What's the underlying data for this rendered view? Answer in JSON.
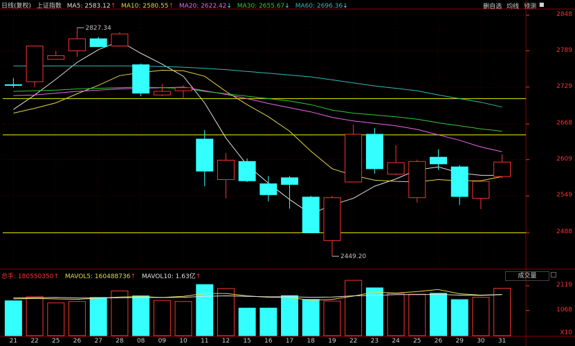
{
  "header": {
    "period": "日线(复权)",
    "index": "上证指数",
    "ma5": "MA5: 2583.12",
    "ma5_arrow": "↑",
    "ma10": "MA10: 2580.55",
    "ma10_arrow": "↑",
    "ma20": "MA20: 2622.42",
    "ma20_arrow": "↓",
    "ma30": "MA30: 2655.67",
    "ma30_arrow": "↓",
    "ma60": "MA60: 2696.36",
    "ma60_arrow": "↓"
  },
  "toolbar": {
    "watchlist": "删自选",
    "avg": "均线",
    "forecast": "预测",
    "box": "■"
  },
  "volume_header": {
    "total": "总手: 180550350",
    "total_arrow": "↑",
    "mavol5": "MAVOL5: 160488736",
    "mavol5_arrow": "↑",
    "mavol10": "MAVOL10: 1.63亿",
    "mavol10_arrow": "↑",
    "selector": "成交量"
  },
  "colors": {
    "up": "#ff3333",
    "down": "#33ffff",
    "ma5": "#e0e0e0",
    "ma10": "#e5d84a",
    "ma20": "#ee66ee",
    "ma30": "#33cc33",
    "ma60": "#33bbbb",
    "hline": "#c8c800",
    "grid": "#8b0000"
  },
  "chart_data": [
    {
      "type": "candlestick",
      "y_ticks": [
        "2848",
        "2789",
        "2729",
        "2668",
        "2609",
        "2549",
        "2488"
      ],
      "ylim": [
        2430,
        2856
      ],
      "x_tick_labels": [
        "21",
        "22",
        "25",
        "26",
        "27",
        "28",
        "08",
        "09",
        "10",
        "11",
        "12",
        "15",
        "16",
        "17",
        "18",
        "19",
        "22",
        "23",
        "24",
        "25",
        "26",
        "29",
        "30",
        "31"
      ],
      "candles": [
        {
          "o": 2733,
          "c": 2733,
          "h": 2744,
          "l": 2728,
          "dir": "down"
        },
        {
          "o": 2738,
          "c": 2797,
          "h": 2797,
          "l": 2729,
          "dir": "up"
        },
        {
          "o": 2775,
          "c": 2781,
          "h": 2789,
          "l": 2775,
          "dir": "up"
        },
        {
          "o": 2789,
          "c": 2809,
          "h": 2827.34,
          "l": 2779,
          "dir": "up"
        },
        {
          "o": 2809,
          "c": 2796,
          "h": 2812,
          "l": 2796,
          "dir": "down"
        },
        {
          "o": 2797,
          "c": 2817,
          "h": 2820,
          "l": 2796,
          "dir": "up"
        },
        {
          "o": 2766,
          "c": 2719,
          "h": 2768,
          "l": 2714,
          "dir": "down"
        },
        {
          "o": 2716,
          "c": 2722,
          "h": 2734,
          "l": 2714,
          "dir": "up"
        },
        {
          "o": 2723,
          "c": 2728,
          "h": 2732,
          "l": 2710,
          "dir": "up"
        },
        {
          "o": 2643,
          "c": 2590,
          "h": 2658,
          "l": 2565,
          "dir": "down"
        },
        {
          "o": 2576,
          "c": 2608,
          "h": 2620,
          "l": 2545,
          "dir": "up"
        },
        {
          "o": 2606,
          "c": 2574,
          "h": 2611,
          "l": 2572,
          "dir": "down"
        },
        {
          "o": 2569,
          "c": 2551,
          "h": 2582,
          "l": 2540,
          "dir": "down"
        },
        {
          "o": 2579,
          "c": 2568,
          "h": 2582,
          "l": 2528,
          "dir": "down"
        },
        {
          "o": 2547,
          "c": 2488,
          "h": 2549,
          "l": 2488,
          "dir": "down"
        },
        {
          "o": 2475,
          "c": 2546,
          "h": 2549,
          "l": 2449.2,
          "dir": "up"
        },
        {
          "o": 2572,
          "c": 2651,
          "h": 2667,
          "l": 2572,
          "dir": "up"
        },
        {
          "o": 2651,
          "c": 2594,
          "h": 2661,
          "l": 2586,
          "dir": "down"
        },
        {
          "o": 2585,
          "c": 2604,
          "h": 2633,
          "l": 2583,
          "dir": "up"
        },
        {
          "o": 2546,
          "c": 2606,
          "h": 2609,
          "l": 2538,
          "dir": "up"
        },
        {
          "o": 2613,
          "c": 2602,
          "h": 2626,
          "l": 2592,
          "dir": "down"
        },
        {
          "o": 2597,
          "c": 2548,
          "h": 2600,
          "l": 2534,
          "dir": "down"
        },
        {
          "o": 2545,
          "c": 2573,
          "h": 2573,
          "l": 2527,
          "dir": "up"
        },
        {
          "o": 2581,
          "c": 2605,
          "h": 2618,
          "l": 2578,
          "dir": "up"
        }
      ],
      "ma": {
        "ma5": [
          2692,
          2716,
          2742,
          2770,
          2791,
          2805,
          2785,
          2767,
          2747,
          2703,
          2645,
          2600,
          2570,
          2543,
          2519,
          2534,
          2545,
          2565,
          2577,
          2592,
          2597,
          2587,
          2583,
          2583
        ],
        "ma10": [
          2686,
          2694,
          2703,
          2718,
          2732,
          2748,
          2753,
          2757,
          2756,
          2747,
          2722,
          2700,
          2680,
          2656,
          2623,
          2594,
          2583,
          2575,
          2573,
          2572,
          2576,
          2574,
          2574,
          2581
        ],
        "ma20": [
          2715,
          2716,
          2719,
          2722,
          2724,
          2726,
          2727,
          2728,
          2729,
          2723,
          2717,
          2710,
          2702,
          2695,
          2688,
          2679,
          2673,
          2669,
          2665,
          2659,
          2650,
          2641,
          2630,
          2622
        ],
        "ma30": [
          2722,
          2723,
          2724,
          2726,
          2727,
          2728,
          2729,
          2728,
          2727,
          2722,
          2718,
          2714,
          2710,
          2706,
          2700,
          2691,
          2686,
          2683,
          2680,
          2676,
          2670,
          2665,
          2660,
          2656
        ],
        "ma60": [
          2764,
          2764,
          2764,
          2764,
          2764,
          2764,
          2764,
          2763,
          2762,
          2760,
          2758,
          2755,
          2752,
          2749,
          2746,
          2741,
          2736,
          2731,
          2727,
          2723,
          2716,
          2710,
          2704,
          2696
        ]
      },
      "horizontal_lines": [
        2710,
        2650,
        2488
      ],
      "annotations": [
        {
          "text": "2827.34",
          "candle": 3
        },
        {
          "text": "2449.20",
          "candle": 15
        }
      ]
    },
    {
      "type": "bar",
      "y_ticks": [
        "2119",
        "1068"
      ],
      "y_tick_values": [
        2119,
        1068
      ],
      "unit_label": "X10",
      "ylim": [
        0,
        2500
      ],
      "volumes": [
        1480,
        1650,
        1390,
        1450,
        1620,
        1900,
        1690,
        1500,
        1450,
        2170,
        2000,
        1170,
        1170,
        1700,
        1540,
        1470,
        2350,
        2030,
        1790,
        1760,
        1800,
        1530,
        1630,
        2010
      ],
      "mavol5": [
        1560,
        1580,
        1560,
        1540,
        1590,
        1640,
        1660,
        1620,
        1670,
        1790,
        1790,
        1690,
        1630,
        1620,
        1500,
        1540,
        1680,
        1850,
        1810,
        1870,
        1960,
        1780,
        1720,
        1750
      ],
      "mavol10": [
        1600,
        1610,
        1620,
        1600,
        1600,
        1610,
        1620,
        1620,
        1630,
        1670,
        1690,
        1670,
        1650,
        1650,
        1630,
        1640,
        1690,
        1710,
        1740,
        1740,
        1750,
        1720,
        1710,
        1740
      ]
    }
  ]
}
